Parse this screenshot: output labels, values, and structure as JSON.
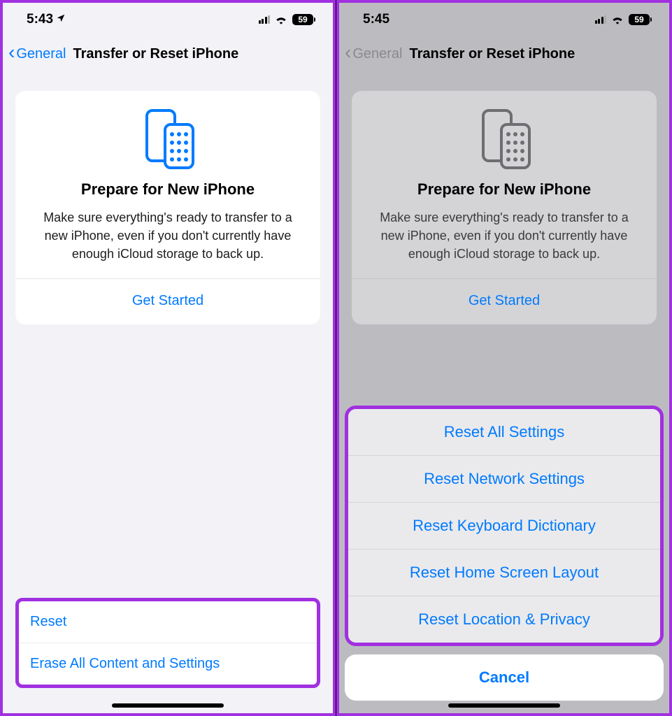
{
  "left": {
    "status": {
      "time": "5:43",
      "battery": "59"
    },
    "nav": {
      "back": "General",
      "title": "Transfer or Reset iPhone"
    },
    "card": {
      "title": "Prepare for New iPhone",
      "desc": "Make sure everything's ready to transfer to a new iPhone, even if you don't currently have enough iCloud storage to back up.",
      "action": "Get Started"
    },
    "rows": {
      "reset": "Reset",
      "erase": "Erase All Content and Settings"
    }
  },
  "right": {
    "status": {
      "time": "5:45",
      "battery": "59"
    },
    "nav": {
      "back": "General",
      "title": "Transfer or Reset iPhone"
    },
    "card": {
      "title": "Prepare for New iPhone",
      "desc": "Make sure everything's ready to transfer to a new iPhone, even if you don't currently have enough iCloud storage to back up.",
      "action": "Get Started"
    },
    "sheet": {
      "opt1": "Reset All Settings",
      "opt2": "Reset Network Settings",
      "opt3": "Reset Keyboard Dictionary",
      "opt4": "Reset Home Screen Layout",
      "opt5": "Reset Location & Privacy",
      "cancel": "Cancel"
    }
  }
}
